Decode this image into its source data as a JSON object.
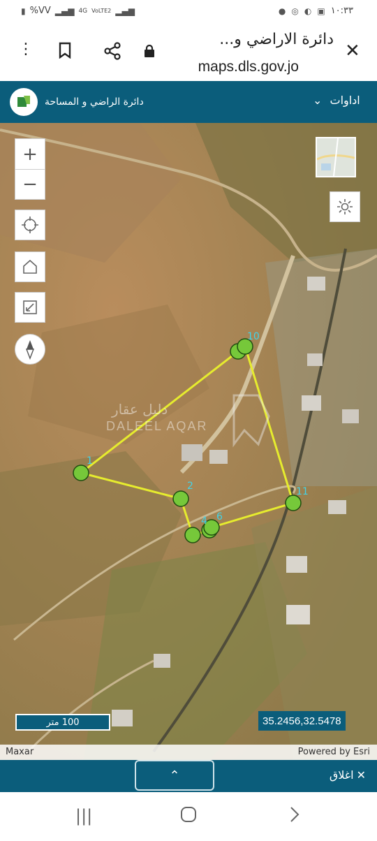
{
  "status_bar": {
    "left_text": "%VV",
    "network": "4G",
    "network2": "VoLTE2",
    "time": "١٠:٣٣"
  },
  "browser": {
    "page_title": "دائرة الاراضي و...",
    "url": "maps.dls.gov.jo"
  },
  "app": {
    "tools_label": "اداوات",
    "department_name": "دائرة الراضي و المساحة"
  },
  "map": {
    "scale_label": "100 متر",
    "coordinates": "35.2456,32.5478",
    "attribution_left": "Maxar",
    "attribution_right": "Powered by Esri",
    "watermark_arabic": "دليل عقار",
    "watermark_latin": "DALEEL AQAR",
    "point_labels": [
      "1",
      "2",
      "4",
      "6",
      "10",
      "11"
    ]
  },
  "bottom_bar": {
    "close_label": "اغلاق"
  }
}
